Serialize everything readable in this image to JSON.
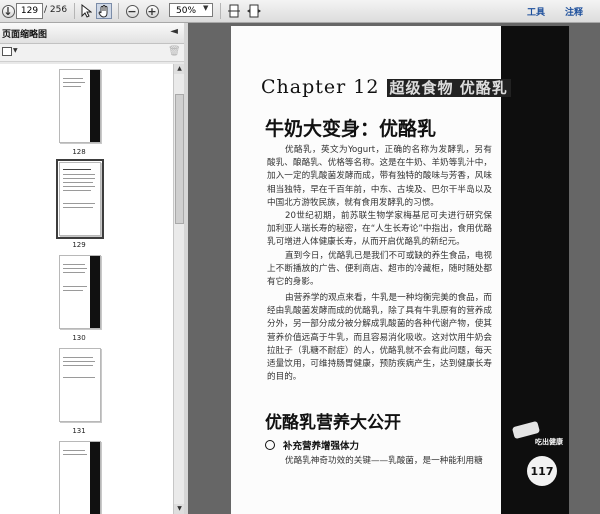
{
  "toolbar": {
    "page_current": "129",
    "page_total": "/ 256",
    "zoom": "50%",
    "tools_label": "工具",
    "comment_label": "注释"
  },
  "sidebar": {
    "title": "页面缩略图",
    "thumbnails": [
      {
        "label": "128"
      },
      {
        "label": "129"
      },
      {
        "label": "130"
      },
      {
        "label": "131"
      }
    ]
  },
  "document": {
    "chapter_prefix": "Chapter 12",
    "chapter_title": "超级食物 优酪乳",
    "heading": "牛奶大变身：优酪乳",
    "paragraphs": [
      "优酪乳，英文为Yogurt，正确的名称为发酵乳，另有酸乳、酿酪乳、优格等名称。这是在牛奶、羊奶等乳汁中，加入一定的乳酸菌发酵而成，带有独特的酸味与芳香，风味相当独特，早在千百年前，中东、古埃及、巴尔干半岛以及中国北方游牧民族，就有食用发酵乳的习惯。",
      "20世纪初期，前苏联生物学家梅基尼可夫进行研究保加利亚人瑞长寿的秘密，在“人生长寿论”中指出，食用优酪乳可增进人体健康长寿，从而开启优酪乳的新纪元。",
      "直到今日，优酪乳已是我们不可或缺的养生食品，电视上不断播放的广告、便利商店、超市的冷藏柜，随时随处都有它的身影。",
      "由营养学的观点来看，牛乳是一种均衡完美的食品，而经由乳酸菌发酵而成的优酪乳，除了具有牛乳原有的营养成分外，另一部分成分被分解成乳酸菌的各种代谢产物，使其营养价值远高于牛乳，而且容易消化吸收。这对饮用牛奶会拉肚子（乳糖不耐症）的人，优酪乳就不会有此问题，每天适量饮用，可维持肠胃健康，预防疾病产生，达到健康长寿的目的。"
    ],
    "section_heading": "优酪乳营养大公开",
    "bullet_title": "补充营养增强体力",
    "bullet_text": "优酪乳神奇功效的关键——乳酸菌，是一种能利用糖",
    "side_badge": "吃出健康",
    "page_number": "117"
  }
}
